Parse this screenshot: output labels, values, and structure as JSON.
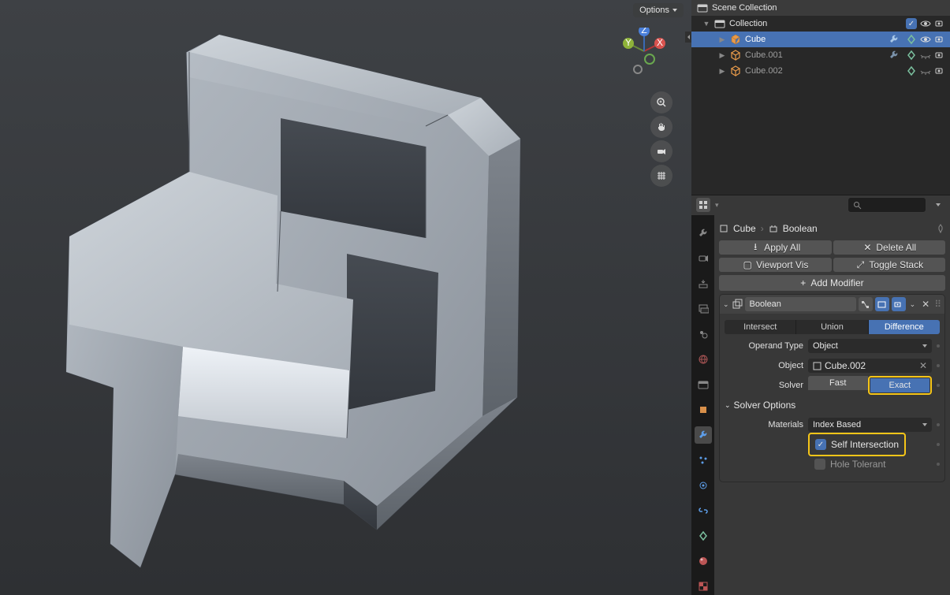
{
  "viewport": {
    "options_label": "Options"
  },
  "outliner": {
    "scene_collection": "Scene Collection",
    "collection": "Collection",
    "items": [
      {
        "name": "Cube",
        "selected": true,
        "visible": true,
        "wrench": true,
        "verts": true
      },
      {
        "name": "Cube.001",
        "selected": false,
        "visible": false,
        "wrench": true,
        "verts": true
      },
      {
        "name": "Cube.002",
        "selected": false,
        "visible": false,
        "wrench": false,
        "verts": true
      }
    ]
  },
  "breadcrumb": {
    "object": "Cube",
    "modifier": "Boolean"
  },
  "buttons": {
    "apply_all": "Apply All",
    "delete_all": "Delete All",
    "viewport_vis": "Viewport Vis",
    "toggle_stack": "Toggle Stack",
    "add_modifier": "Add Modifier"
  },
  "modifier": {
    "name": "Boolean",
    "modes": {
      "intersect": "Intersect",
      "union": "Union",
      "difference": "Difference"
    },
    "active_mode": "difference",
    "operand_type_label": "Operand Type",
    "operand_type_value": "Object",
    "object_label": "Object",
    "object_value": "Cube.002",
    "solver_label": "Solver",
    "solver_fast": "Fast",
    "solver_exact": "Exact",
    "solver_active": "Exact",
    "solver_options_label": "Solver Options",
    "materials_label": "Materials",
    "materials_value": "Index Based",
    "self_intersection": "Self Intersection",
    "hole_tolerant": "Hole Tolerant"
  }
}
